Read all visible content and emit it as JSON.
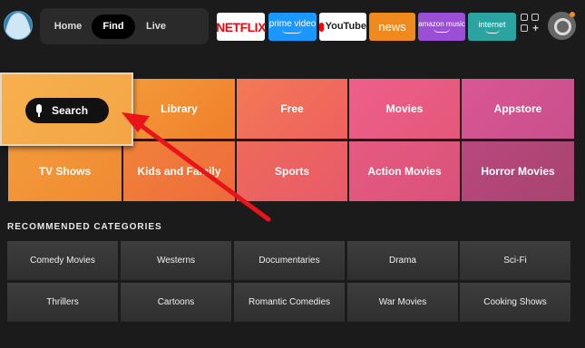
{
  "nav": {
    "tabs": [
      {
        "label": "Home",
        "active": false
      },
      {
        "label": "Find",
        "active": true
      },
      {
        "label": "Live",
        "active": false
      }
    ]
  },
  "apps": [
    {
      "name": "netflix",
      "label": "NETFLIX"
    },
    {
      "name": "prime-video",
      "label": "prime video"
    },
    {
      "name": "youtube",
      "label": "YouTube"
    },
    {
      "name": "news",
      "label": "news"
    },
    {
      "name": "amazon-music",
      "label": "amazon music"
    },
    {
      "name": "internet",
      "label": "internet"
    }
  ],
  "icons": {
    "profile": "user-avatar-icon",
    "apps_grid": "apps-grid-icon",
    "settings": "gear-icon",
    "mic": "microphone-icon"
  },
  "find": {
    "search_label": "Search",
    "tiles_row1": [
      "Library",
      "Free",
      "Movies",
      "Appstore"
    ],
    "tiles_row2": [
      "TV Shows",
      "Kids and Family",
      "Sports",
      "Action Movies",
      "Horror Movies"
    ]
  },
  "recommended": {
    "title": "RECOMMENDED CATEGORIES",
    "row1": [
      "Comedy Movies",
      "Westerns",
      "Documentaries",
      "Drama",
      "Sci-Fi"
    ],
    "row2": [
      "Thrillers",
      "Cartoons",
      "Romantic Comedies",
      "War Movies",
      "Cooking Shows"
    ]
  },
  "colors": {
    "search_tile": "#f4a545",
    "tile_orange": "#f07f2a",
    "tile_pink": "#e8557a",
    "tile_magenta": "#c8508c",
    "arrow": "#e8141a",
    "notification": "#f08a1c"
  }
}
